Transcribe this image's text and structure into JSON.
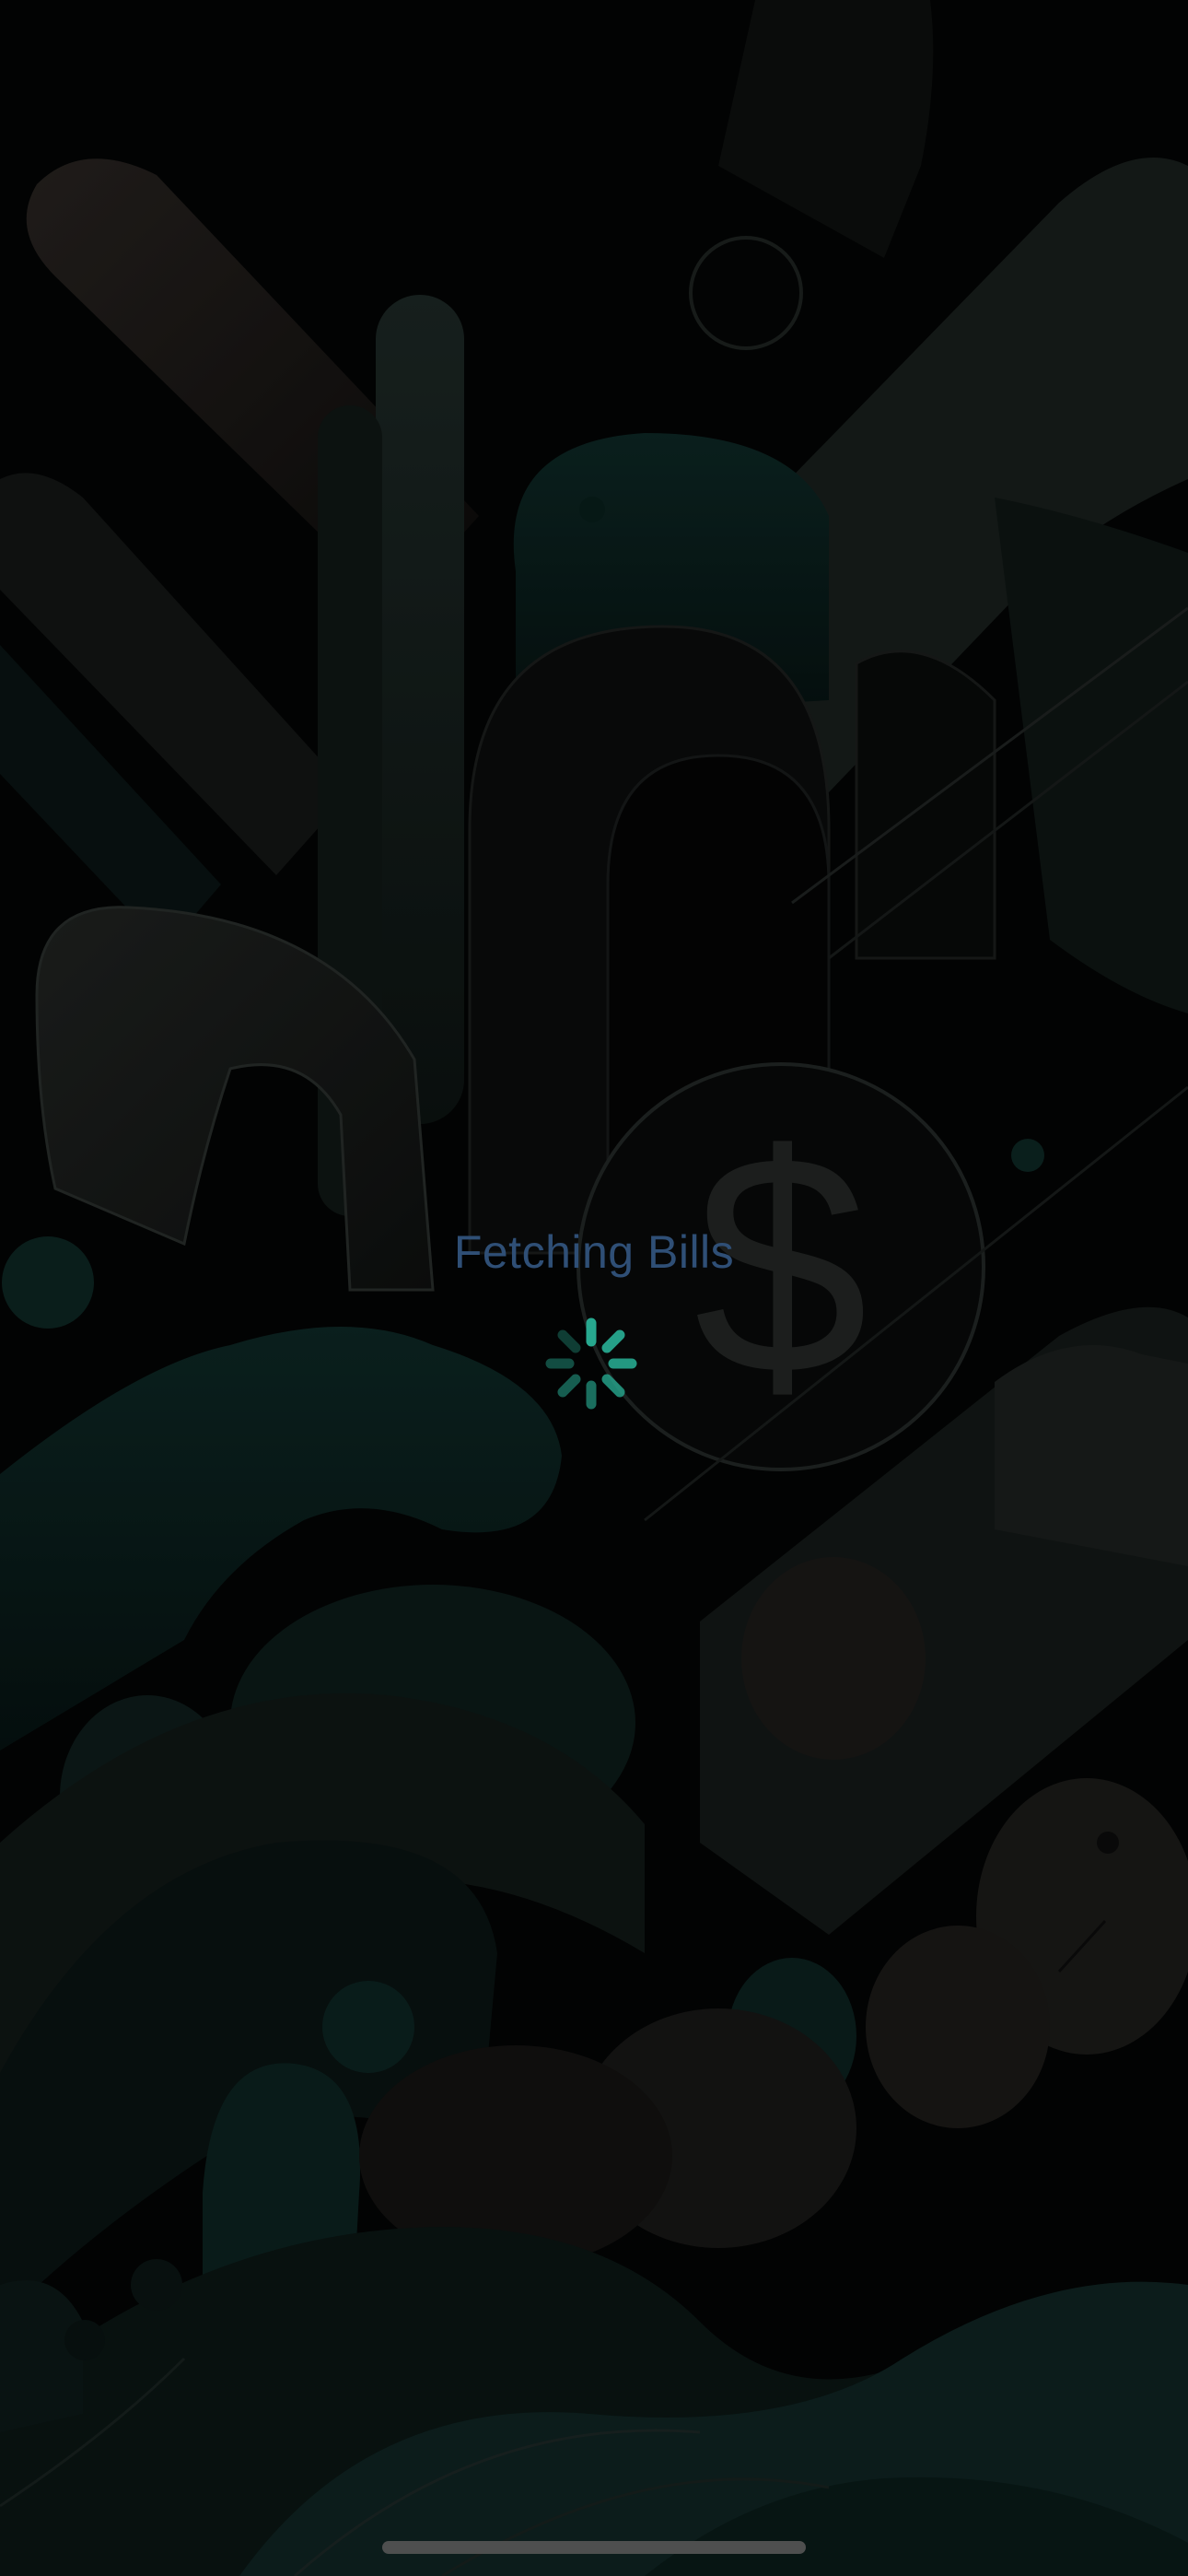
{
  "loading": {
    "label": "Fetching Bills"
  },
  "background": {
    "currency_symbol": "$"
  },
  "colors": {
    "label": "#2f4f76",
    "spinner": "#27a88f",
    "teal_dark": "#0b2522",
    "gray_dark": "#1a1c1b"
  },
  "icons": {
    "spinner": "activity-spinner-icon",
    "coin": "dollar-coin-icon"
  }
}
